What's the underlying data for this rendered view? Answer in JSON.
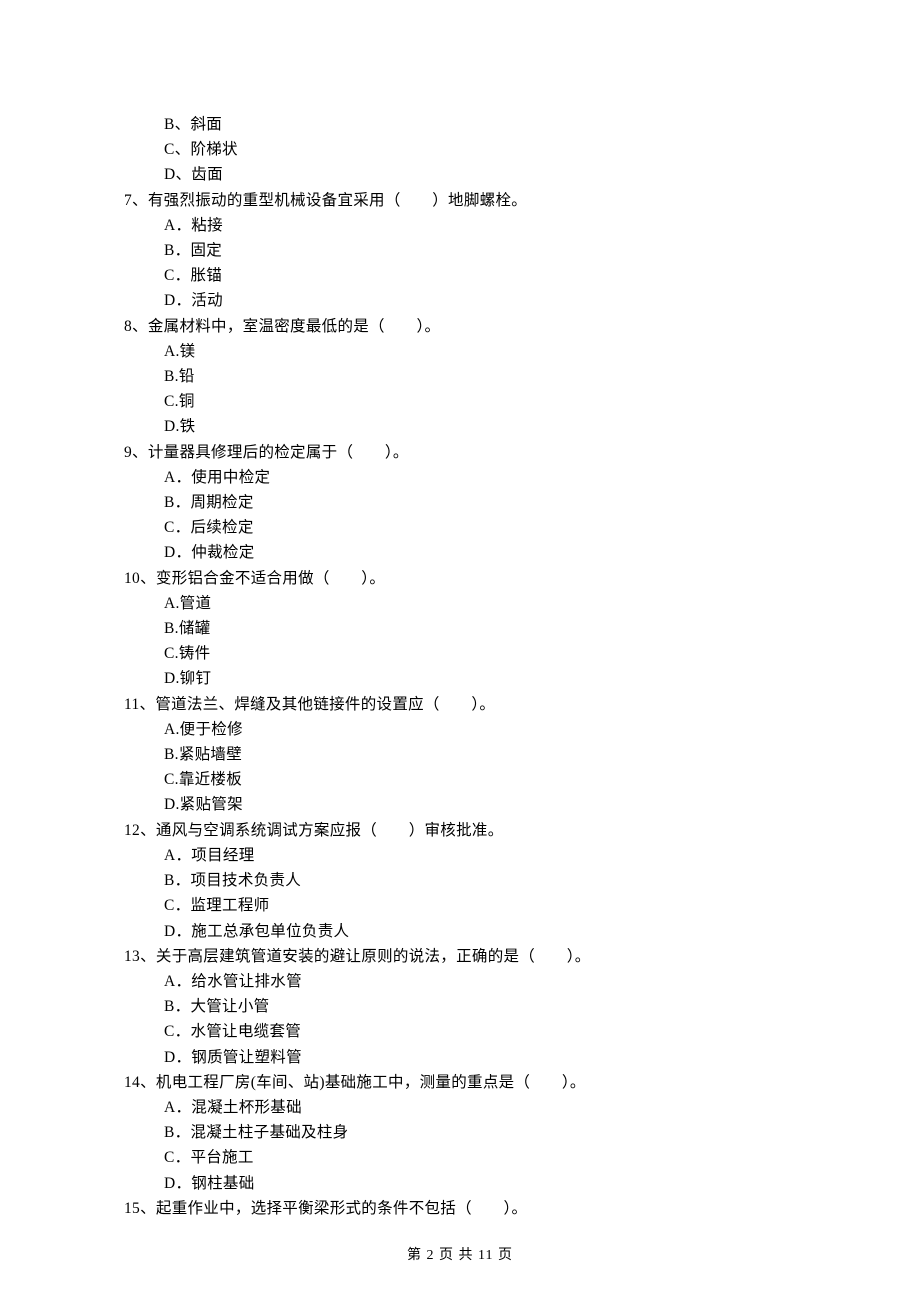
{
  "leading_options": [
    "B、斜面",
    "C、阶梯状",
    "D、齿面"
  ],
  "questions": [
    {
      "stem": "7、有强烈振动的重型机械设备宜采用（　　）地脚螺栓。",
      "options": [
        "A．粘接",
        "B．固定",
        "C．胀锚",
        "D．活动"
      ]
    },
    {
      "stem": "8、金属材料中，室温密度最低的是（　　）。",
      "options": [
        "A.镁",
        "B.铅",
        "C.铜",
        "D.铁"
      ]
    },
    {
      "stem": "9、计量器具修理后的检定属于（　　）。",
      "options": [
        "A．使用中检定",
        "B．周期检定",
        "C．后续检定",
        "D．仲裁检定"
      ]
    },
    {
      "stem": "10、变形铝合金不适合用做（　　）。",
      "options": [
        "A.管道",
        "B.储罐",
        "C.铸件",
        "D.铆钉"
      ]
    },
    {
      "stem": "11、管道法兰、焊缝及其他链接件的设置应（　　）。",
      "options": [
        "A.便于检修",
        "B.紧贴墙壁",
        "C.靠近楼板",
        "D.紧贴管架"
      ]
    },
    {
      "stem": "12、通风与空调系统调试方案应报（　　）审核批准。",
      "options": [
        "A．项目经理",
        "B．项目技术负责人",
        "C．监理工程师",
        "D．施工总承包单位负责人"
      ]
    },
    {
      "stem": "13、关于高层建筑管道安装的避让原则的说法，正确的是（　　）。",
      "options": [
        "A．给水管让排水管",
        "B．大管让小管",
        "C．水管让电缆套管",
        "D．钢质管让塑料管"
      ]
    },
    {
      "stem": "14、机电工程厂房(车间、站)基础施工中，测量的重点是（　　）。",
      "options": [
        "A．混凝土杯形基础",
        "B．混凝土柱子基础及柱身",
        "C．平台施工",
        "D．钢柱基础"
      ]
    },
    {
      "stem": "15、起重作业中，选择平衡梁形式的条件不包括（　　）。",
      "options": []
    }
  ],
  "footer": "第 2 页 共 11 页"
}
